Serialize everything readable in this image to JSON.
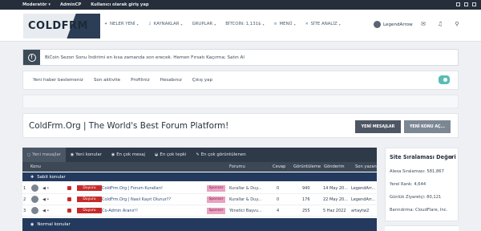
{
  "staffbar": {
    "moderator": "Moderatör ▾",
    "admincp": "AdminCP",
    "login_as": "Kullanıcı olarak giriş yap"
  },
  "logo": {
    "text": "COLDFRM"
  },
  "nav": {
    "items": [
      {
        "label": "NELER YENİ",
        "icon": "light-icon"
      },
      {
        "label": "KAYNAKLAR",
        "icon": "download-icon"
      },
      {
        "label": "GRUPLAR",
        "icon": ""
      },
      {
        "label": "BİTCOİN: 1,131$",
        "icon": ""
      },
      {
        "label": "MENÜ",
        "icon": "menu-icon"
      },
      {
        "label": "SİTE ANALİZ",
        "icon": "wrench-icon"
      }
    ],
    "user": "LegendArrow"
  },
  "notice": {
    "text": "BiCoin Sezon Sonu İndirimi en kısa zamanda son erecek. Hemen Fırsatı Kaçırma; Satın Al"
  },
  "subnav": {
    "items": [
      "Yeni haber beslemeniz",
      "Son aktivite",
      "Profiliniz",
      "Hesabınız",
      "Çıkış yap"
    ]
  },
  "title": {
    "text": "ColdFrm.Org | The World's Best Forum Platform!",
    "btn_new_messages": "YENİ MESAJLAR",
    "btn_new_topic": "YENİ KONU AÇ..."
  },
  "forum": {
    "tabs": [
      "Yeni mesajlar",
      "Yeni konular",
      "En çok mesaj",
      "En çok tepki",
      "En çok görüntülenen"
    ],
    "columns": {
      "konu": "Konu",
      "forumu": "Forumu",
      "cevap": "Cevap",
      "goruntuleme": "Görüntüleme",
      "gonderim": "Gönderim",
      "son_yazan": "Son yazan"
    },
    "sections": {
      "pinned": "Sabit konular",
      "normal": "Normal konular"
    },
    "rows": [
      {
        "num": "1",
        "badge": "Duyuru",
        "title": "ColdFrm.Org | Forum Kuralları!",
        "sponsor": "Sponsor",
        "forum": "Kurallar & Duy...",
        "replies": "0",
        "views": "940",
        "date": "14 May 20...",
        "last": "LegendArr..."
      },
      {
        "num": "2",
        "badge": "Duyuru",
        "title": "ColdFrm.Org | Nasıl Kayıt Olunur??",
        "sponsor": "Sponsor",
        "forum": "Kurallar & Duy...",
        "replies": "0",
        "views": "176",
        "date": "22 May 20...",
        "last": "LegendArr..."
      },
      {
        "num": "3",
        "badge": "Duyuru",
        "title": "Co-Admin Aranır!!",
        "sponsor": "Sponsor",
        "forum": "Yönetici Başvu...",
        "replies": "4",
        "views": "255",
        "date": "5 Haz 2022",
        "last": "artaytw2"
      }
    ]
  },
  "sidebar": {
    "title": "Site Sıralaması Değeri",
    "lines": [
      "Alexa Sıralaması: 581,867",
      "Yerel Rank: 4,644",
      "Günlük Ziyaretçi: 80,121",
      "Barındırma: CloudFlare, Inc."
    ]
  }
}
